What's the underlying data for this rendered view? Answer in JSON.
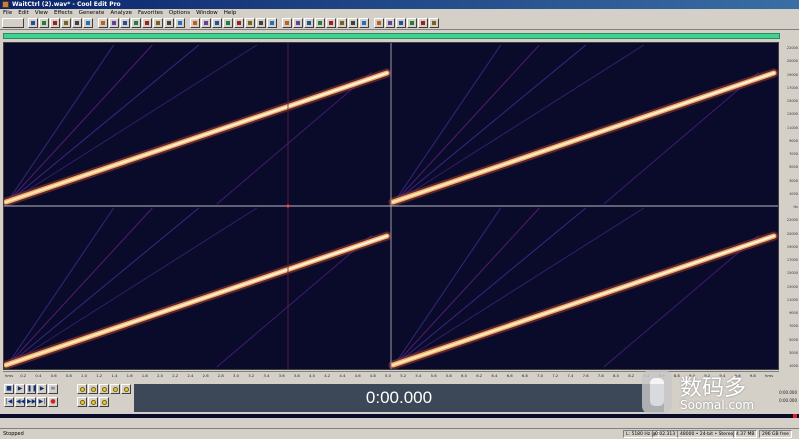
{
  "window": {
    "title": "WaitCtrl (2).wav* - Cool Edit Pro"
  },
  "menu": [
    "File",
    "Edit",
    "View",
    "Effects",
    "Generate",
    "Analyze",
    "Favorites",
    "Options",
    "Window",
    "Help"
  ],
  "ruler_labels": [
    "22000",
    "20000",
    "19000",
    "17000",
    "15000",
    "13000",
    "11000",
    "9000",
    "7000",
    "5000",
    "3000",
    "1000",
    "Hz",
    "22000",
    "20000",
    "19000",
    "17000",
    "15000",
    "13000",
    "11000",
    "9000",
    "7000",
    "5000",
    "3000",
    "1000"
  ],
  "timeline_labels": [
    "hms",
    "0.2",
    "0.4",
    "0.6",
    "0.8",
    "1.0",
    "1.2",
    "1.4",
    "1.6",
    "1.8",
    "2.0",
    "2.2",
    "2.4",
    "2.6",
    "2.8",
    "3.0",
    "3.2",
    "3.4",
    "3.6",
    "3.8",
    "4.0",
    "4.2",
    "4.4",
    "4.6",
    "4.8",
    "5.0",
    "5.2",
    "5.4",
    "5.6",
    "5.8",
    "6.0",
    "6.2",
    "6.4",
    "6.6",
    "6.8",
    "7.0",
    "7.2",
    "7.4",
    "7.6",
    "7.8",
    "8.0",
    "8.2",
    "8.4",
    "8.6",
    "8.8",
    "9.0",
    "9.2",
    "9.4",
    "9.6",
    "9.8",
    "hms"
  ],
  "time_display": "0:00.000",
  "selection": {
    "begin": "0:00.000",
    "end": "0:00.000"
  },
  "status": {
    "state": "Stopped",
    "freq": "L: 5180 Hz @",
    "time": "0:02.313",
    "format": "48000 • 24-bit • Stereo",
    "size": "4.37 MB",
    "free": "296 GB free"
  },
  "watermark": {
    "cn": "数码多",
    "url": "Soomal.com"
  },
  "colors": {
    "spectrum_bg": "#0a0b2a",
    "time_panel": "#3c4757",
    "overview": "#3fd38f"
  }
}
